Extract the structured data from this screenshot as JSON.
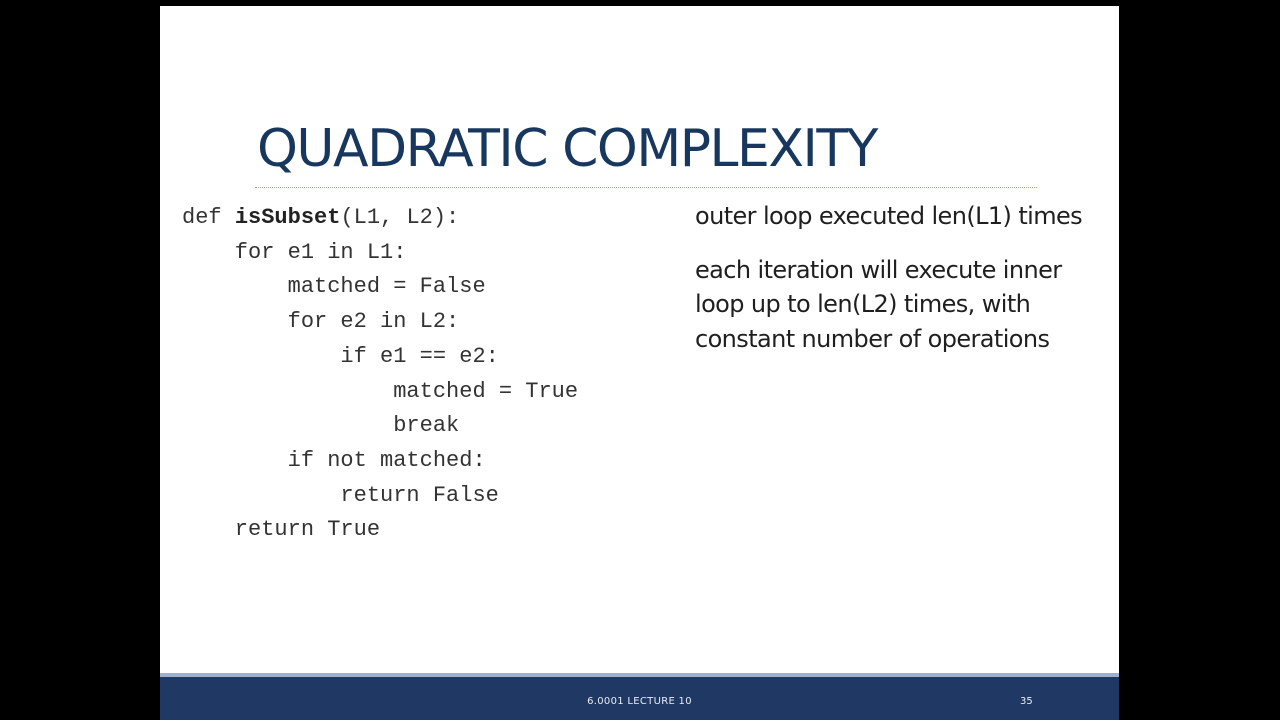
{
  "slide": {
    "title": "QUADRATIC COMPLEXITY",
    "code": {
      "line1_prefix": "def ",
      "line1_name": "isSubset",
      "line1_suffix": "(L1, L2):",
      "line2": "    for e1 in L1:",
      "line3": "        matched = False",
      "line4": "        for e2 in L2:",
      "line5": "            if e1 == e2:",
      "line6": "                matched = True",
      "line7": "                break",
      "line8": "        if not matched:",
      "line9": "            return False",
      "line10": "    return True"
    },
    "notes": [
      "outer loop executed len(L1) times",
      "each iteration will execute inner loop up to len(L2) times, with constant number of operations"
    ],
    "footer": {
      "label": "6.0001 LECTURE 10",
      "page_number": "35"
    }
  },
  "colors": {
    "title": "#17375e",
    "footer_bar": "#1f3864",
    "background": "#000000"
  }
}
